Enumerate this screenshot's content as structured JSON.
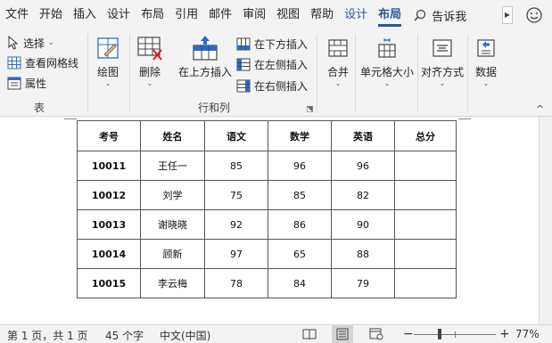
{
  "menu": {
    "tabs": [
      "文件",
      "开始",
      "插入",
      "设计",
      "布局",
      "引用",
      "邮件",
      "审阅",
      "视图",
      "帮助"
    ],
    "context_tabs": [
      "设计",
      "布局"
    ],
    "active_tab": "布局",
    "search_label": "告诉我",
    "scroll_glyph": "▶"
  },
  "ribbon": {
    "table_group": {
      "select": "选择",
      "gridlines": "查看网格线",
      "properties": "属性",
      "label": "表"
    },
    "draw": "绘图",
    "delete": "删除",
    "rows_cols": {
      "insert_above": "在上方插入",
      "insert_below": "在下方插入",
      "insert_left": "在左侧插入",
      "insert_right": "在右侧插入",
      "label": "行和列"
    },
    "merge": "合并",
    "cell_size": "单元格大小",
    "alignment": "对齐方式",
    "data": "数据",
    "caret": "⌄",
    "launcher": "⬔",
    "collapse": "^"
  },
  "table": {
    "headers": [
      "考号",
      "姓名",
      "语文",
      "数学",
      "英语",
      "总分"
    ],
    "rows": [
      [
        "10011",
        "王任一",
        "85",
        "96",
        "96",
        ""
      ],
      [
        "10012",
        "刘学",
        "75",
        "85",
        "82",
        ""
      ],
      [
        "10013",
        "谢晓晓",
        "92",
        "86",
        "90",
        ""
      ],
      [
        "10014",
        "顾新",
        "97",
        "65",
        "88",
        ""
      ],
      [
        "10015",
        "李云梅",
        "78",
        "84",
        "79",
        ""
      ]
    ]
  },
  "status": {
    "page": "第 1 页，共 1 页",
    "words": "45 个字",
    "language": "中文(中国)",
    "zoom_minus": "−",
    "zoom_plus": "+",
    "zoom": "77%",
    "zoom_level": 0.77
  },
  "colors": {
    "accent": "#2b579a",
    "ribbon_bg": "#f3f3f3",
    "icon_blue": "#2b6cc4",
    "icon_red": "#e81123"
  }
}
